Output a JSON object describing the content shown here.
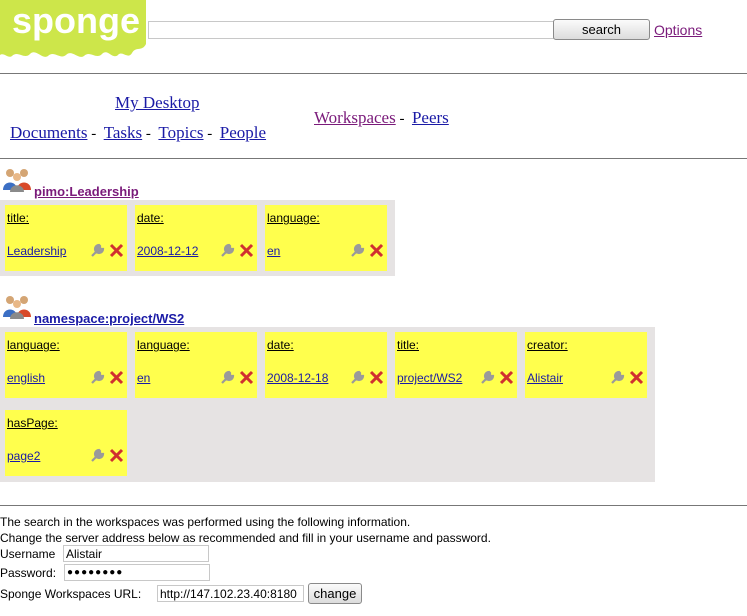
{
  "header": {
    "logo_text": "sponge",
    "search_value": "",
    "search_button": "search",
    "options_link": "Options"
  },
  "nav": {
    "my_desktop": "My Desktop",
    "documents": "Documents",
    "tasks": "Tasks",
    "topics": "Topics",
    "people": "People",
    "workspaces": "Workspaces",
    "peers": "Peers",
    "separator": "-"
  },
  "workspaces": [
    {
      "title": "pimo:Leadership",
      "properties": [
        {
          "label": "title:",
          "value": "Leadership"
        },
        {
          "label": "date:",
          "value": "2008-12-12"
        },
        {
          "label": "language:",
          "value": "en"
        }
      ]
    },
    {
      "title": "namespace:project/WS2",
      "properties": [
        {
          "label": "language:",
          "value": "english"
        },
        {
          "label": "language:",
          "value": "en"
        },
        {
          "label": "date:",
          "value": "2008-12-18"
        },
        {
          "label": "title:",
          "value": "project/WS2"
        },
        {
          "label": "creator:",
          "value": "Alistair"
        },
        {
          "label": "hasPage:",
          "value": "page2"
        }
      ]
    }
  ],
  "footer": {
    "info_line1": "The search in the workspaces was performed using the following information.",
    "info_line2": "Change the server address below as recommended and fill in your username and password.",
    "username_label": "Username",
    "username_value": "Alistair",
    "password_label": "Password:",
    "password_value": "●●●●●●●●",
    "url_label": "Sponge Workspaces URL:",
    "url_value": "http://147.102.23.40:8180",
    "change_button": "change"
  },
  "colors": {
    "card_yellow": "#ffff4d",
    "panel_gray": "#e6e3e3",
    "logo_green": "#cde64a",
    "link_blue": "#1a1aa6",
    "visited_purple": "#7a1a7a",
    "delete_red": "#d03030"
  }
}
